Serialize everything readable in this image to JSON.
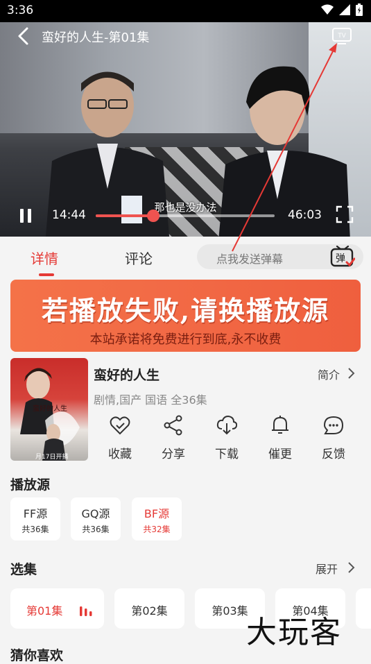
{
  "status_bar": {
    "time": "3:36",
    "icons": [
      "wifi-icon",
      "signal-icon",
      "battery-icon"
    ]
  },
  "player": {
    "title": "蛮好的人生-第01集",
    "subtitle": "那也是没办法",
    "current_time": "14:44",
    "total_time": "46:03",
    "progress_fraction": 0.32,
    "accent_color": "#ef5350"
  },
  "tabs": [
    {
      "label": "详情",
      "active": true
    },
    {
      "label": "评论",
      "active": false
    }
  ],
  "danmu": {
    "placeholder": "点我发送弹幕",
    "icon_text": "弹"
  },
  "banner": {
    "main_text": "若播放失败,请换播放源",
    "sub_text": "本站承诺将免费进行到底,永不收费"
  },
  "drama": {
    "title": "蛮好的人生",
    "meta": "剧情,国产 国语 全36集",
    "intro_label": "简介",
    "poster_text": "蛮好的人生",
    "poster_date": "月17日开播"
  },
  "actions": [
    {
      "label": "收藏",
      "icon": "heart-icon"
    },
    {
      "label": "分享",
      "icon": "share-icon"
    },
    {
      "label": "下载",
      "icon": "download-icon"
    },
    {
      "label": "催更",
      "icon": "bell-icon"
    },
    {
      "label": "反馈",
      "icon": "feedback-icon"
    }
  ],
  "sources_section": {
    "title": "播放源",
    "items": [
      {
        "name": "FF源",
        "count": "共36集",
        "active": false
      },
      {
        "name": "GQ源",
        "count": "共36集",
        "active": false
      },
      {
        "name": "BF源",
        "count": "共32集",
        "active": true
      }
    ]
  },
  "episodes_section": {
    "title": "选集",
    "expand_label": "展开",
    "items": [
      {
        "label": "第01集",
        "active": true
      },
      {
        "label": "第02集",
        "active": false
      },
      {
        "label": "第03集",
        "active": false
      },
      {
        "label": "第04集",
        "active": false
      }
    ]
  },
  "watermark": "大玩客",
  "guess_section": {
    "title": "猜你喜欢"
  },
  "colors": {
    "accent": "#e53935",
    "banner": "#f26b46",
    "background": "#f4f4f4"
  }
}
